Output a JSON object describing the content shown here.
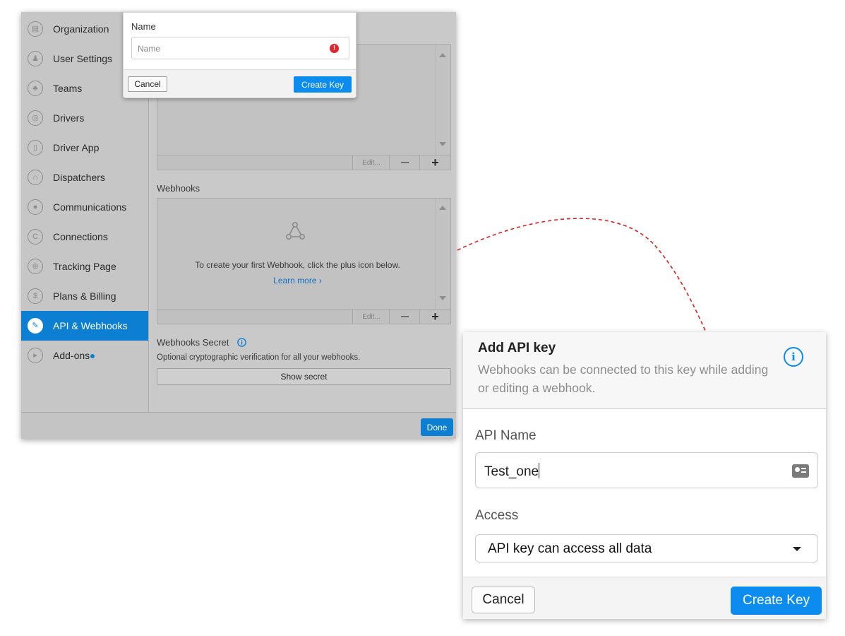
{
  "sidebar": {
    "items": [
      {
        "label": "Organization",
        "icon": "building-icon",
        "glyph": "▤"
      },
      {
        "label": "User Settings",
        "icon": "user-icon",
        "glyph": "♟"
      },
      {
        "label": "Teams",
        "icon": "team-icon",
        "glyph": "♣"
      },
      {
        "label": "Drivers",
        "icon": "steering-wheel-icon",
        "glyph": "◎"
      },
      {
        "label": "Driver App",
        "icon": "phone-icon",
        "glyph": "▯"
      },
      {
        "label": "Dispatchers",
        "icon": "headset-icon",
        "glyph": "∩"
      },
      {
        "label": "Communications",
        "icon": "chat-icon",
        "glyph": "●"
      },
      {
        "label": "Connections",
        "icon": "link-icon",
        "glyph": "C"
      },
      {
        "label": "Tracking Page",
        "icon": "target-icon",
        "glyph": "⊕"
      },
      {
        "label": "Plans & Billing",
        "icon": "dollar-icon",
        "glyph": "$"
      },
      {
        "label": "API & Webhooks",
        "icon": "wrench-icon",
        "glyph": "✎",
        "active": true
      },
      {
        "label": "Add-ons",
        "icon": "plugin-icon",
        "glyph": "▸"
      }
    ]
  },
  "api_keys_list": {
    "toolbar": {
      "edit": "Edit...",
      "minus": "−",
      "plus": "+"
    }
  },
  "webhooks": {
    "title": "Webhooks",
    "empty_message": "To create your first Webhook, click the plus icon below.",
    "learn_more": "Learn more ›",
    "toolbar": {
      "edit": "Edit...",
      "minus": "−",
      "plus": "+"
    }
  },
  "webhooks_secret": {
    "title": "Webhooks Secret",
    "hint": "Optional cryptographic verification for all your webhooks.",
    "button": "Show secret"
  },
  "window_footer": {
    "done": "Done"
  },
  "small_popup": {
    "label": "Name",
    "placeholder": "Name",
    "error_glyph": "!",
    "cancel": "Cancel",
    "create": "Create Key"
  },
  "zoom_dialog": {
    "title": "Add API key",
    "subtitle": "Webhooks can be connected to this key while adding or editing a webhook.",
    "info_glyph": "i",
    "name_label": "API Name",
    "name_value": "Test_one",
    "access_label": "Access",
    "access_value": "API key can access all data",
    "cancel": "Cancel",
    "create": "Create Key"
  },
  "colors": {
    "accent": "#0d8cf0",
    "sidebar_active": "#0d7fd2",
    "error": "#e3242b",
    "callout_arrow": "#e02020"
  }
}
